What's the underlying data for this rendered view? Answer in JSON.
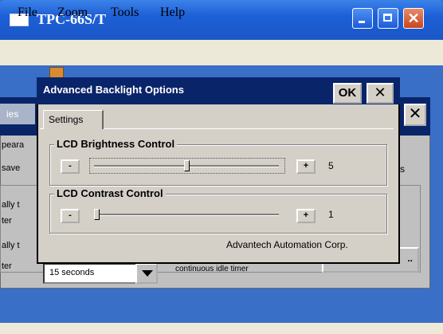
{
  "window": {
    "title": "TPC-66S/T"
  },
  "menu": [
    {
      "label": "File"
    },
    {
      "label": "Zoom"
    },
    {
      "label": "Tools"
    },
    {
      "label": "Help"
    }
  ],
  "background_dialog": {
    "tab_fragment": "ies",
    "fragments": [
      "peara",
      "save",
      "ally t",
      "ter",
      "ally t",
      "ter"
    ],
    "right_fragment": "s",
    "select_value": "15 seconds",
    "hint_fragment": "continuous idle timer",
    "button_fragment": ".."
  },
  "dialog": {
    "title": "Advanced Backlight Options",
    "ok_label": "OK",
    "close_label": "✕",
    "tab_label": "Settings",
    "brightness": {
      "label": "LCD Brightness Control",
      "minus_label": "-",
      "plus_label": "+",
      "value": "5",
      "level": 0.5
    },
    "contrast": {
      "label": "LCD Contrast Control",
      "minus_label": "-",
      "plus_label": "+",
      "value": "1",
      "level": 0.0
    },
    "credit": "Advantech Automation Corp."
  },
  "colors": {
    "title_blue": "#1d5fd6",
    "dialog_title": "#0a246a",
    "face": "#d4d0c8"
  }
}
